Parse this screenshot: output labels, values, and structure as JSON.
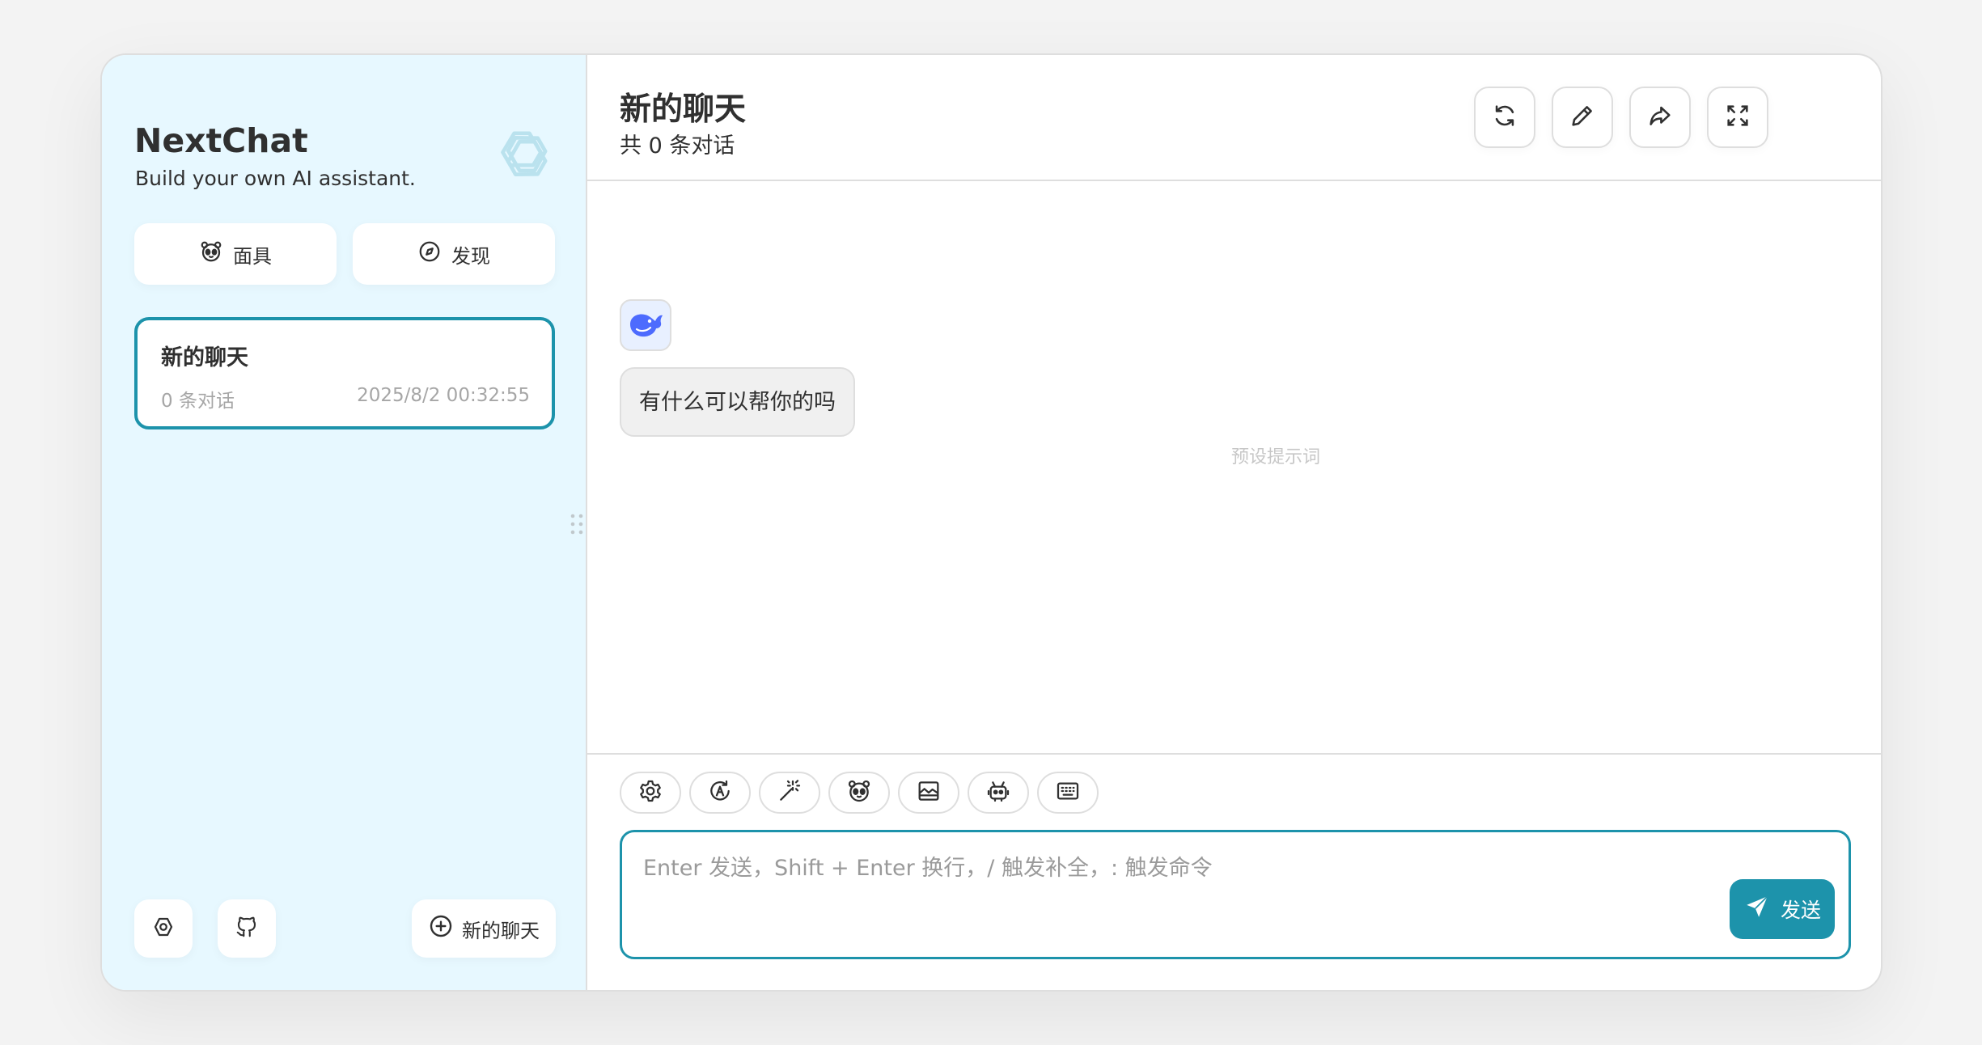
{
  "sidebar": {
    "app_title": "NextChat",
    "app_subtitle": "Build your own AI assistant.",
    "logo_icon": "openai-icon",
    "mask_button": {
      "label": "面具",
      "icon": "mask-icon"
    },
    "discover_button": {
      "label": "发现",
      "icon": "discover-icon"
    },
    "chats": [
      {
        "title": "新的聊天",
        "count": "0 条对话",
        "date": "2025/8/2 00:32:55",
        "selected": true
      }
    ],
    "footer": {
      "settings_icon": "settings-icon",
      "github_icon": "github-icon",
      "new_chat_label": "新的聊天"
    }
  },
  "header": {
    "title": "新的聊天",
    "subtitle": "共 0 条对话",
    "buttons": [
      "refresh-icon",
      "edit-icon",
      "share-icon",
      "fullscreen-icon"
    ]
  },
  "messages": [
    {
      "role": "assistant",
      "avatar": "deepseek-whale-icon",
      "text": "有什么可以帮你的吗",
      "tag": "预设提示词"
    }
  ],
  "input": {
    "actions": [
      "settings-icon",
      "model-icon",
      "magic-wand-icon",
      "mask-icon",
      "image-icon",
      "robot-icon",
      "keyboard-icon"
    ],
    "placeholder": "Enter 发送，Shift + Enter 换行，/ 触发补全，: 触发命令",
    "value": "",
    "send_label": "发送"
  },
  "colors": {
    "accent": "#1d93ab",
    "sidebar_bg": "#e7f8ff",
    "border": "#dedede",
    "bubble_bg": "#f0f0f0"
  }
}
